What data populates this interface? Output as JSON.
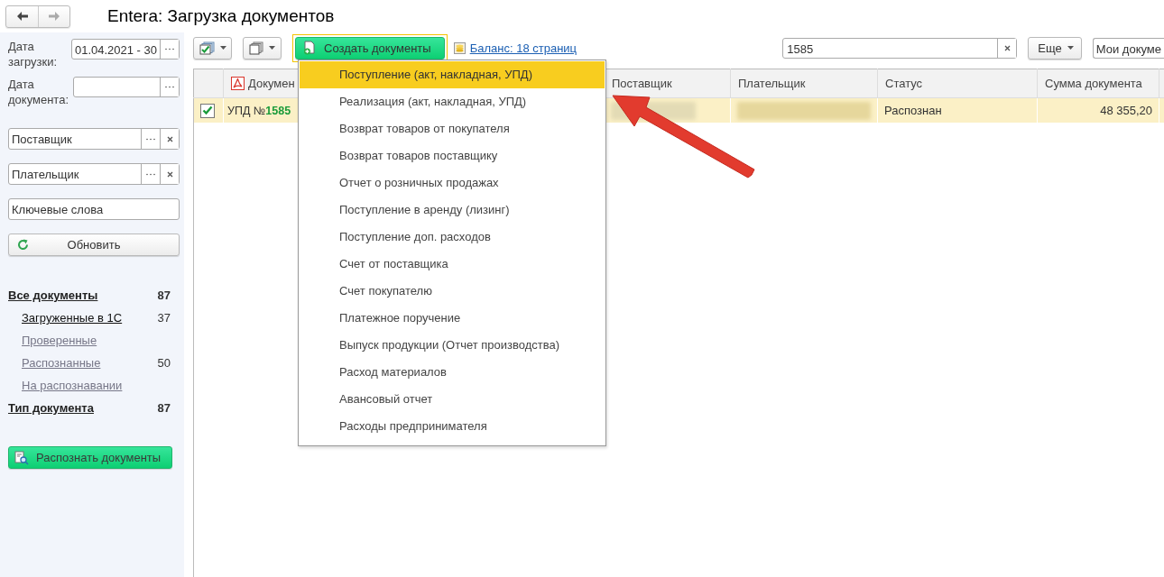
{
  "window": {
    "title": "Entera: Загрузка документов"
  },
  "nav": [
    {
      "kind": "back",
      "disabled": false
    },
    {
      "kind": "forward",
      "disabled": true
    }
  ],
  "filters": [
    {
      "kind": "period",
      "label": "Дата загрузки:",
      "value": "01.04.2021 - 30"
    },
    {
      "kind": "period",
      "label": "Дата документа:"
    },
    {
      "kind": "lookup",
      "placeholder": "Поставщик"
    },
    {
      "kind": "lookup",
      "placeholder": "Плательщик"
    },
    {
      "kind": "text",
      "placeholder": "Ключевые слова"
    }
  ],
  "refresh_button": "Обновить",
  "categories": [
    {
      "label": "Все документы",
      "count": "87",
      "children": [
        {
          "label": "Загруженные в 1С",
          "count": "37",
          "selected": true
        },
        {
          "label": "Проверенные",
          "selected": false
        },
        {
          "label": "Распознанные",
          "count": "50",
          "selected": false
        },
        {
          "label": "На распознавании",
          "selected": false
        }
      ]
    },
    {
      "label": "Тип документа",
      "count": "87"
    }
  ],
  "recognize_button": "Распознать документы",
  "toolbar": {
    "create_button": "Создать документы",
    "balance_link": "Баланс: 18 страниц",
    "search": {
      "value": "1585"
    },
    "more_button": "Еще",
    "view_select": "Мои докуме"
  },
  "table": {
    "columns": [
      "Докумен",
      "Поставщик",
      "Плательщик",
      "Статус",
      "Сумма документа"
    ],
    "rows": [
      {
        "checked": true,
        "selected": true,
        "document": "УПД №**1585**",
        "status": "Распознан",
        "amount": "48 355,20"
      }
    ]
  },
  "create_menu": {
    "items": [
      {
        "label": "Поступление (акт, накладная, УПД)",
        "selected": true
      },
      {
        "label": "Реализация (акт, накладная, УПД)",
        "selected": false
      },
      {
        "label": "Возврат товаров от покупателя",
        "selected": false
      },
      {
        "label": "Возврат товаров поставщику",
        "selected": false
      },
      {
        "label": "Отчет о розничных продажах",
        "selected": false
      },
      {
        "label": "Поступление в аренду (лизинг)",
        "selected": false
      },
      {
        "label": "Поступление доп. расходов",
        "selected": false
      },
      {
        "label": "Счет от поставщика",
        "selected": false
      },
      {
        "label": "Счет покупателю",
        "selected": false
      },
      {
        "label": "Платежное поручение",
        "selected": false
      },
      {
        "label": "Выпуск продукции (Отчет производства)",
        "selected": false
      },
      {
        "label": "Расход материалов",
        "selected": false
      },
      {
        "label": "Авансовый отчет",
        "selected": false
      },
      {
        "label": "Расходы предпринимателя",
        "selected": false
      }
    ]
  }
}
